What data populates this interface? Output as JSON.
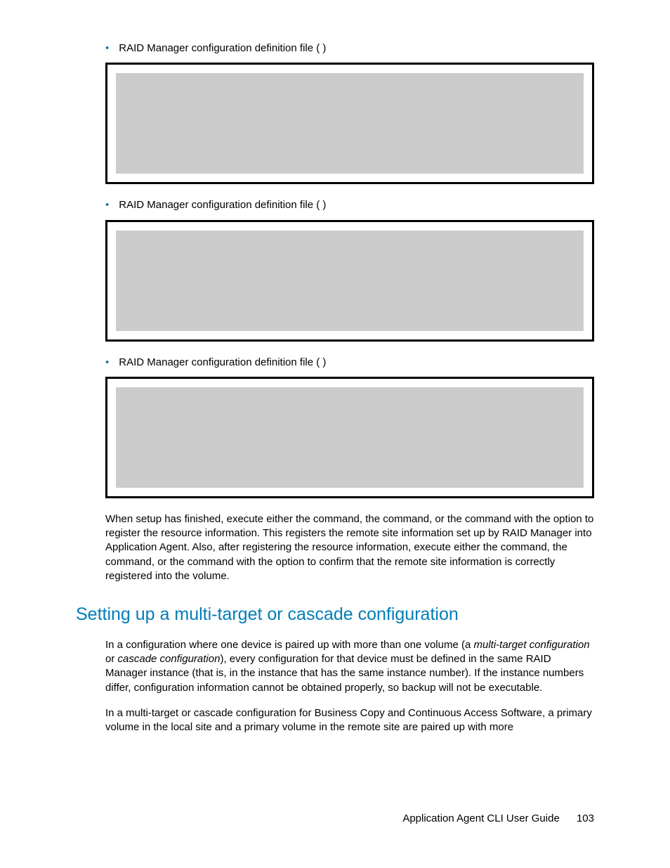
{
  "bullets": [
    {
      "text": "RAID Manager configuration definition file (                            )"
    },
    {
      "text": "RAID Manager configuration definition file (                            )"
    },
    {
      "text": "RAID Manager configuration definition file (                            )"
    }
  ],
  "para1": "When setup has finished, execute either the                            command, the                      command, or the                              command with the                  option to register the resource information. This registers the remote site information set up by RAID Manager into Application Agent. Also, after registering the resource information, execute either the                            command, the                              command, or the                              command with the            option to confirm that the remote site information is correctly registered into the volume.",
  "heading": "Setting up a multi-target or cascade configuration",
  "para2_pre": "In a configuration where one device is paired up with more than one volume (a ",
  "para2_em1": "multi-target configuration",
  "para2_mid": " or ",
  "para2_em2": "cascade configuration",
  "para2_post": "), every configuration for that device must be defined in the same RAID Manager instance (that is, in the instance that has the same instance number). If the instance numbers differ, configuration information cannot be obtained properly, so backup will not be executable.",
  "para3": "In a multi-target or cascade configuration for Business Copy and Continuous Access Software, a primary volume in the local site and a primary volume in the remote site are paired up with more",
  "footer_text": "Application Agent CLI User Guide",
  "page_number": "103"
}
